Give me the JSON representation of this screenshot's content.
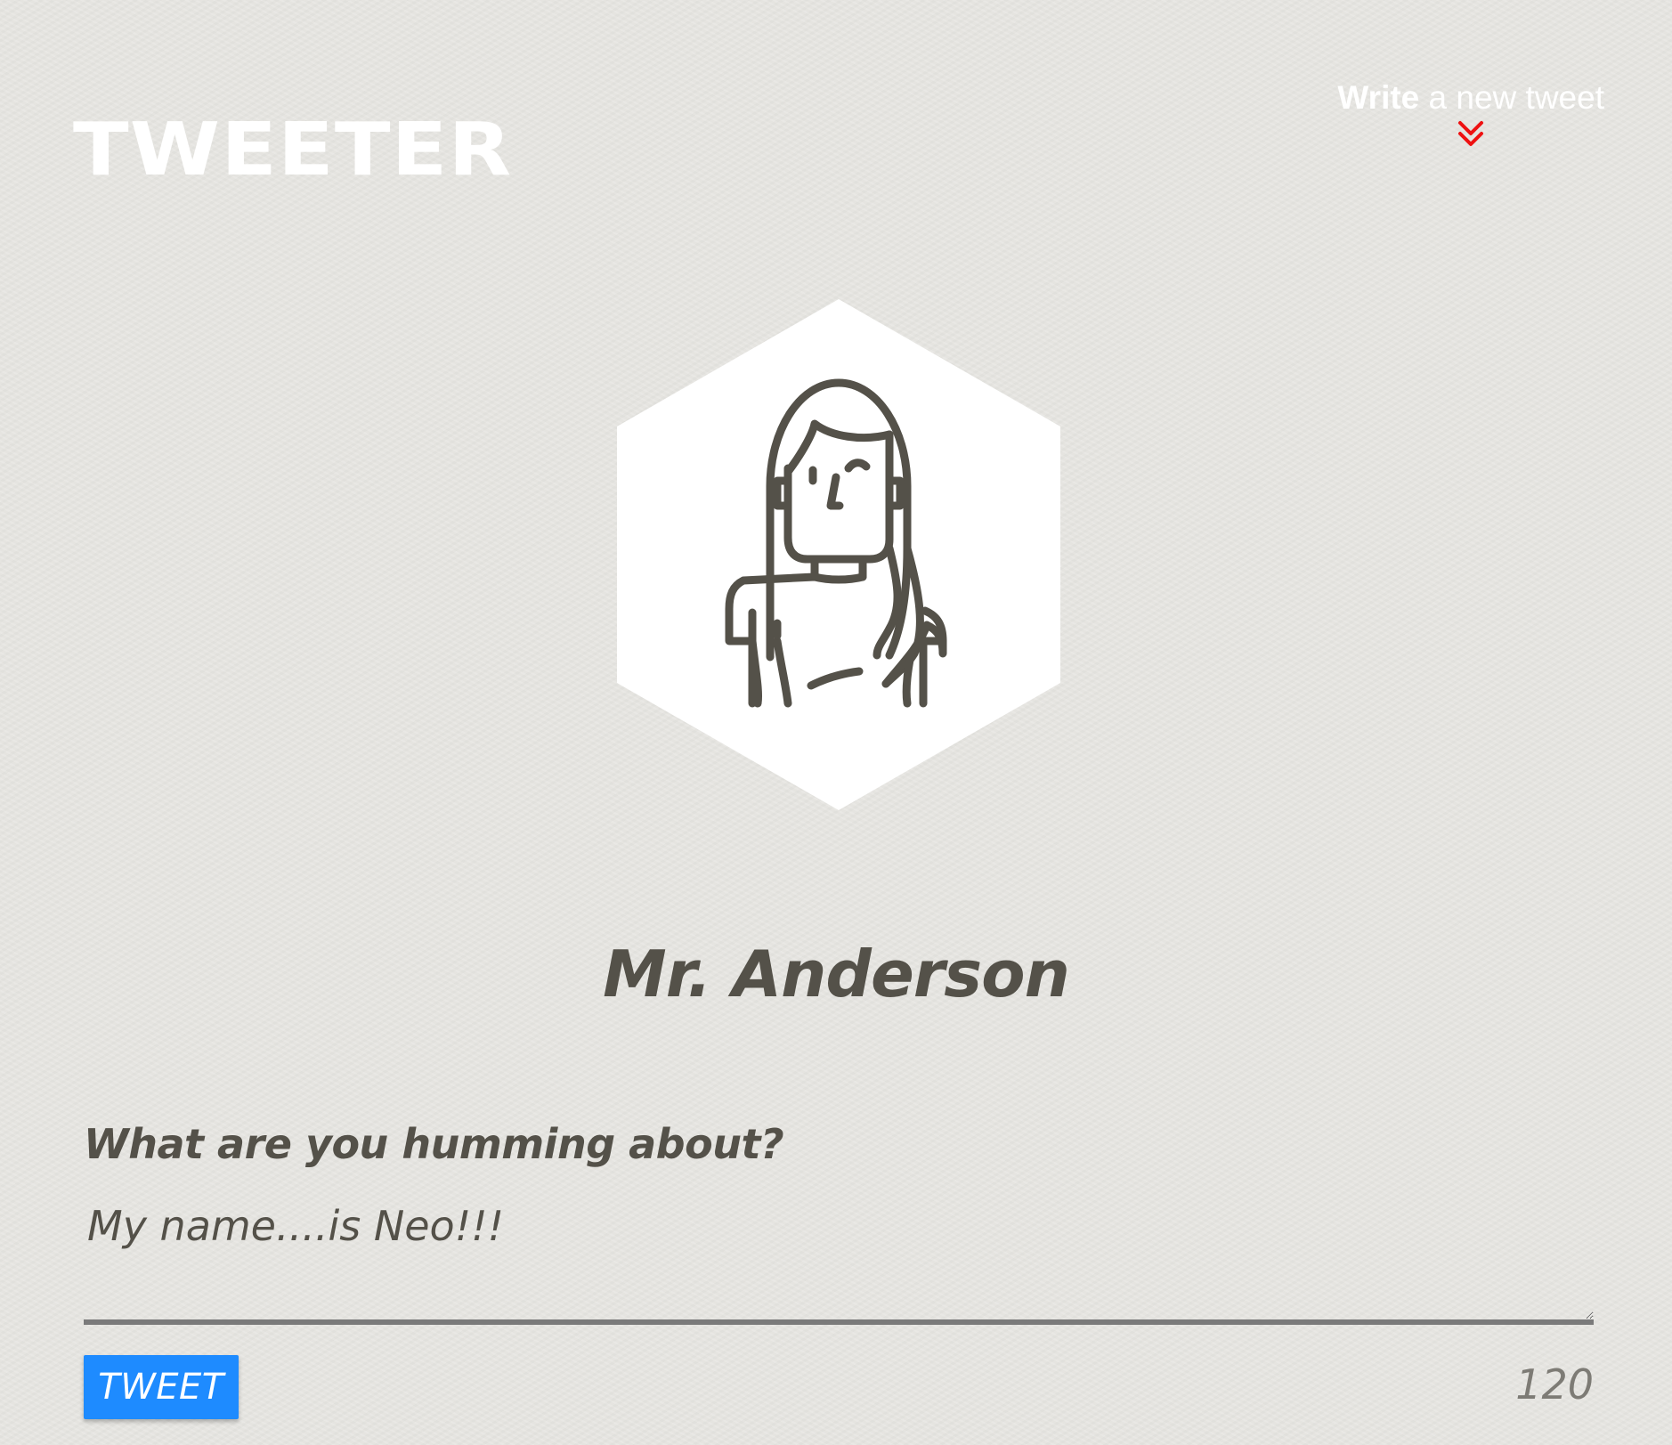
{
  "header": {
    "brand": "TWEETER",
    "nav_write_bold": "Write",
    "nav_write_rest": " a new tweet",
    "nav_icon": "double-chevron-down-icon",
    "nav_icon_color": "#ee1111"
  },
  "profile": {
    "avatar_icon": "woman-avatar-icon",
    "name": "Mr. Anderson"
  },
  "composer": {
    "label": "What are you humming about?",
    "text_value": "My name....is Neo!!!",
    "button_label": "TWEET",
    "char_count": "120",
    "button_color": "#1e8bff"
  }
}
